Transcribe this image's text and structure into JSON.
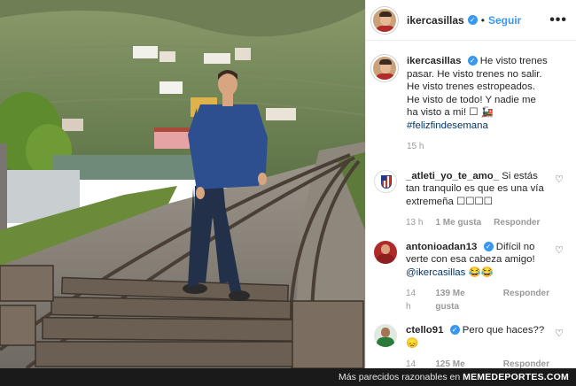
{
  "post": {
    "username": "ikercasillas",
    "follow_label": "Seguir",
    "dot": "•",
    "more": "•••"
  },
  "caption": {
    "username": "ikercasillas",
    "text": "He visto trenes pasar. He visto trenes no salir. He visto trenes estropeados. He visto de todo! Y nadie me ha visto a mi! ☐ 🚂",
    "hashtag": "#felizfindesemana",
    "time": "15 h"
  },
  "comments": [
    {
      "username": "_atleti_yo_te_amo_",
      "text": "Si estás tan tranquilo es que es una vía extremeña ☐☐☐☐",
      "time": "13 h",
      "likes": "1 Me gusta",
      "reply": "Responder",
      "verified": false
    },
    {
      "username": "antonioadan13",
      "text": "Difícil no verte con esa cabeza amigo!",
      "mention": "@ikercasillas",
      "emoji": "😂😂",
      "time": "14 h",
      "likes": "139 Me gusta",
      "reply": "Responder",
      "verified": true
    },
    {
      "username": "ctello91",
      "text": "Pero que haces??😞",
      "time": "14 h",
      "likes": "125 Me gusta",
      "reply": "Responder",
      "verified": true
    }
  ],
  "footer": {
    "text": "Más parecidos razonables en",
    "site": "MEMEDEPORTES.COM"
  },
  "colors": {
    "link_blue": "#3897f0",
    "hashtag_navy": "#003569",
    "muted": "#999999"
  }
}
